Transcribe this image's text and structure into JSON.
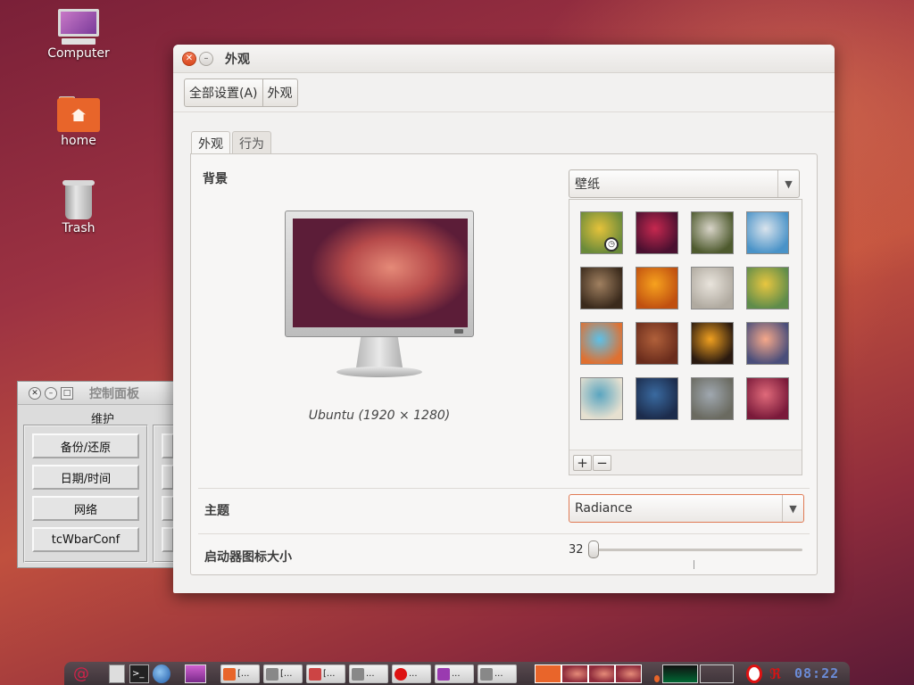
{
  "desktop": {
    "icons": [
      {
        "label": "Computer",
        "icon": "computer-icon"
      },
      {
        "label": "home",
        "icon": "home-folder-icon"
      },
      {
        "label": "Trash",
        "icon": "trash-icon"
      }
    ]
  },
  "window": {
    "title": "外观",
    "breadcrumb": [
      "全部设置(A)",
      "外观"
    ],
    "tabs": [
      "外观",
      "行为"
    ],
    "background_label": "背景",
    "wallpaper_combo": "壁纸",
    "resolution_caption": "Ubuntu (1920 × 1280)",
    "add_label": "+",
    "remove_label": "−",
    "theme_label": "主题",
    "theme_value": "Radiance",
    "launcher_label": "启动器图标大小",
    "launcher_size": "32",
    "launcher_slider_fraction": 0.0
  },
  "wallpapers": [
    {
      "colors": [
        "#e5c23a",
        "#6a8a3a"
      ],
      "selected": true
    },
    {
      "colors": [
        "#c6284f",
        "#4a1030"
      ],
      "selected": false
    },
    {
      "colors": [
        "#d8d4c8",
        "#4e5a2e"
      ],
      "selected": false
    },
    {
      "colors": [
        "#d9e3ec",
        "#4a93c8"
      ],
      "selected": false
    },
    {
      "colors": [
        "#a08060",
        "#3a2a1c"
      ],
      "selected": false
    },
    {
      "colors": [
        "#f7a21e",
        "#c05010"
      ],
      "selected": false
    },
    {
      "colors": [
        "#e9e4dc",
        "#b0aaa0"
      ],
      "selected": false
    },
    {
      "colors": [
        "#e8c640",
        "#5f8c4a"
      ],
      "selected": false
    },
    {
      "colors": [
        "#5cc0e8",
        "#e07030"
      ],
      "selected": false
    },
    {
      "colors": [
        "#b0603a",
        "#6a2c1c"
      ],
      "selected": false
    },
    {
      "colors": [
        "#f0a020",
        "#2a1a10"
      ],
      "selected": false
    },
    {
      "colors": [
        "#f6a88a",
        "#4a4e7a"
      ],
      "selected": false
    },
    {
      "colors": [
        "#5aa5c0",
        "#e6e0d0"
      ],
      "selected": false
    },
    {
      "colors": [
        "#3a6aa0",
        "#1c2c4c"
      ],
      "selected": false
    },
    {
      "colors": [
        "#a0a8b0",
        "#6a6a60"
      ],
      "selected": false
    },
    {
      "colors": [
        "#e06a7a",
        "#7a1a3a"
      ],
      "selected": false
    }
  ],
  "control_panel": {
    "title": "控制面板",
    "group": "维护",
    "buttons": [
      "备份/还原",
      "日期/时间",
      "网络",
      "tcWbarConf"
    ]
  },
  "taskbar": {
    "tasks": [
      "[...",
      "[...",
      "[...",
      "...",
      "...",
      "...",
      "..."
    ],
    "clock": "08:22"
  },
  "colors": {
    "accent": "#e07a54",
    "close_button": "#d9481e"
  }
}
